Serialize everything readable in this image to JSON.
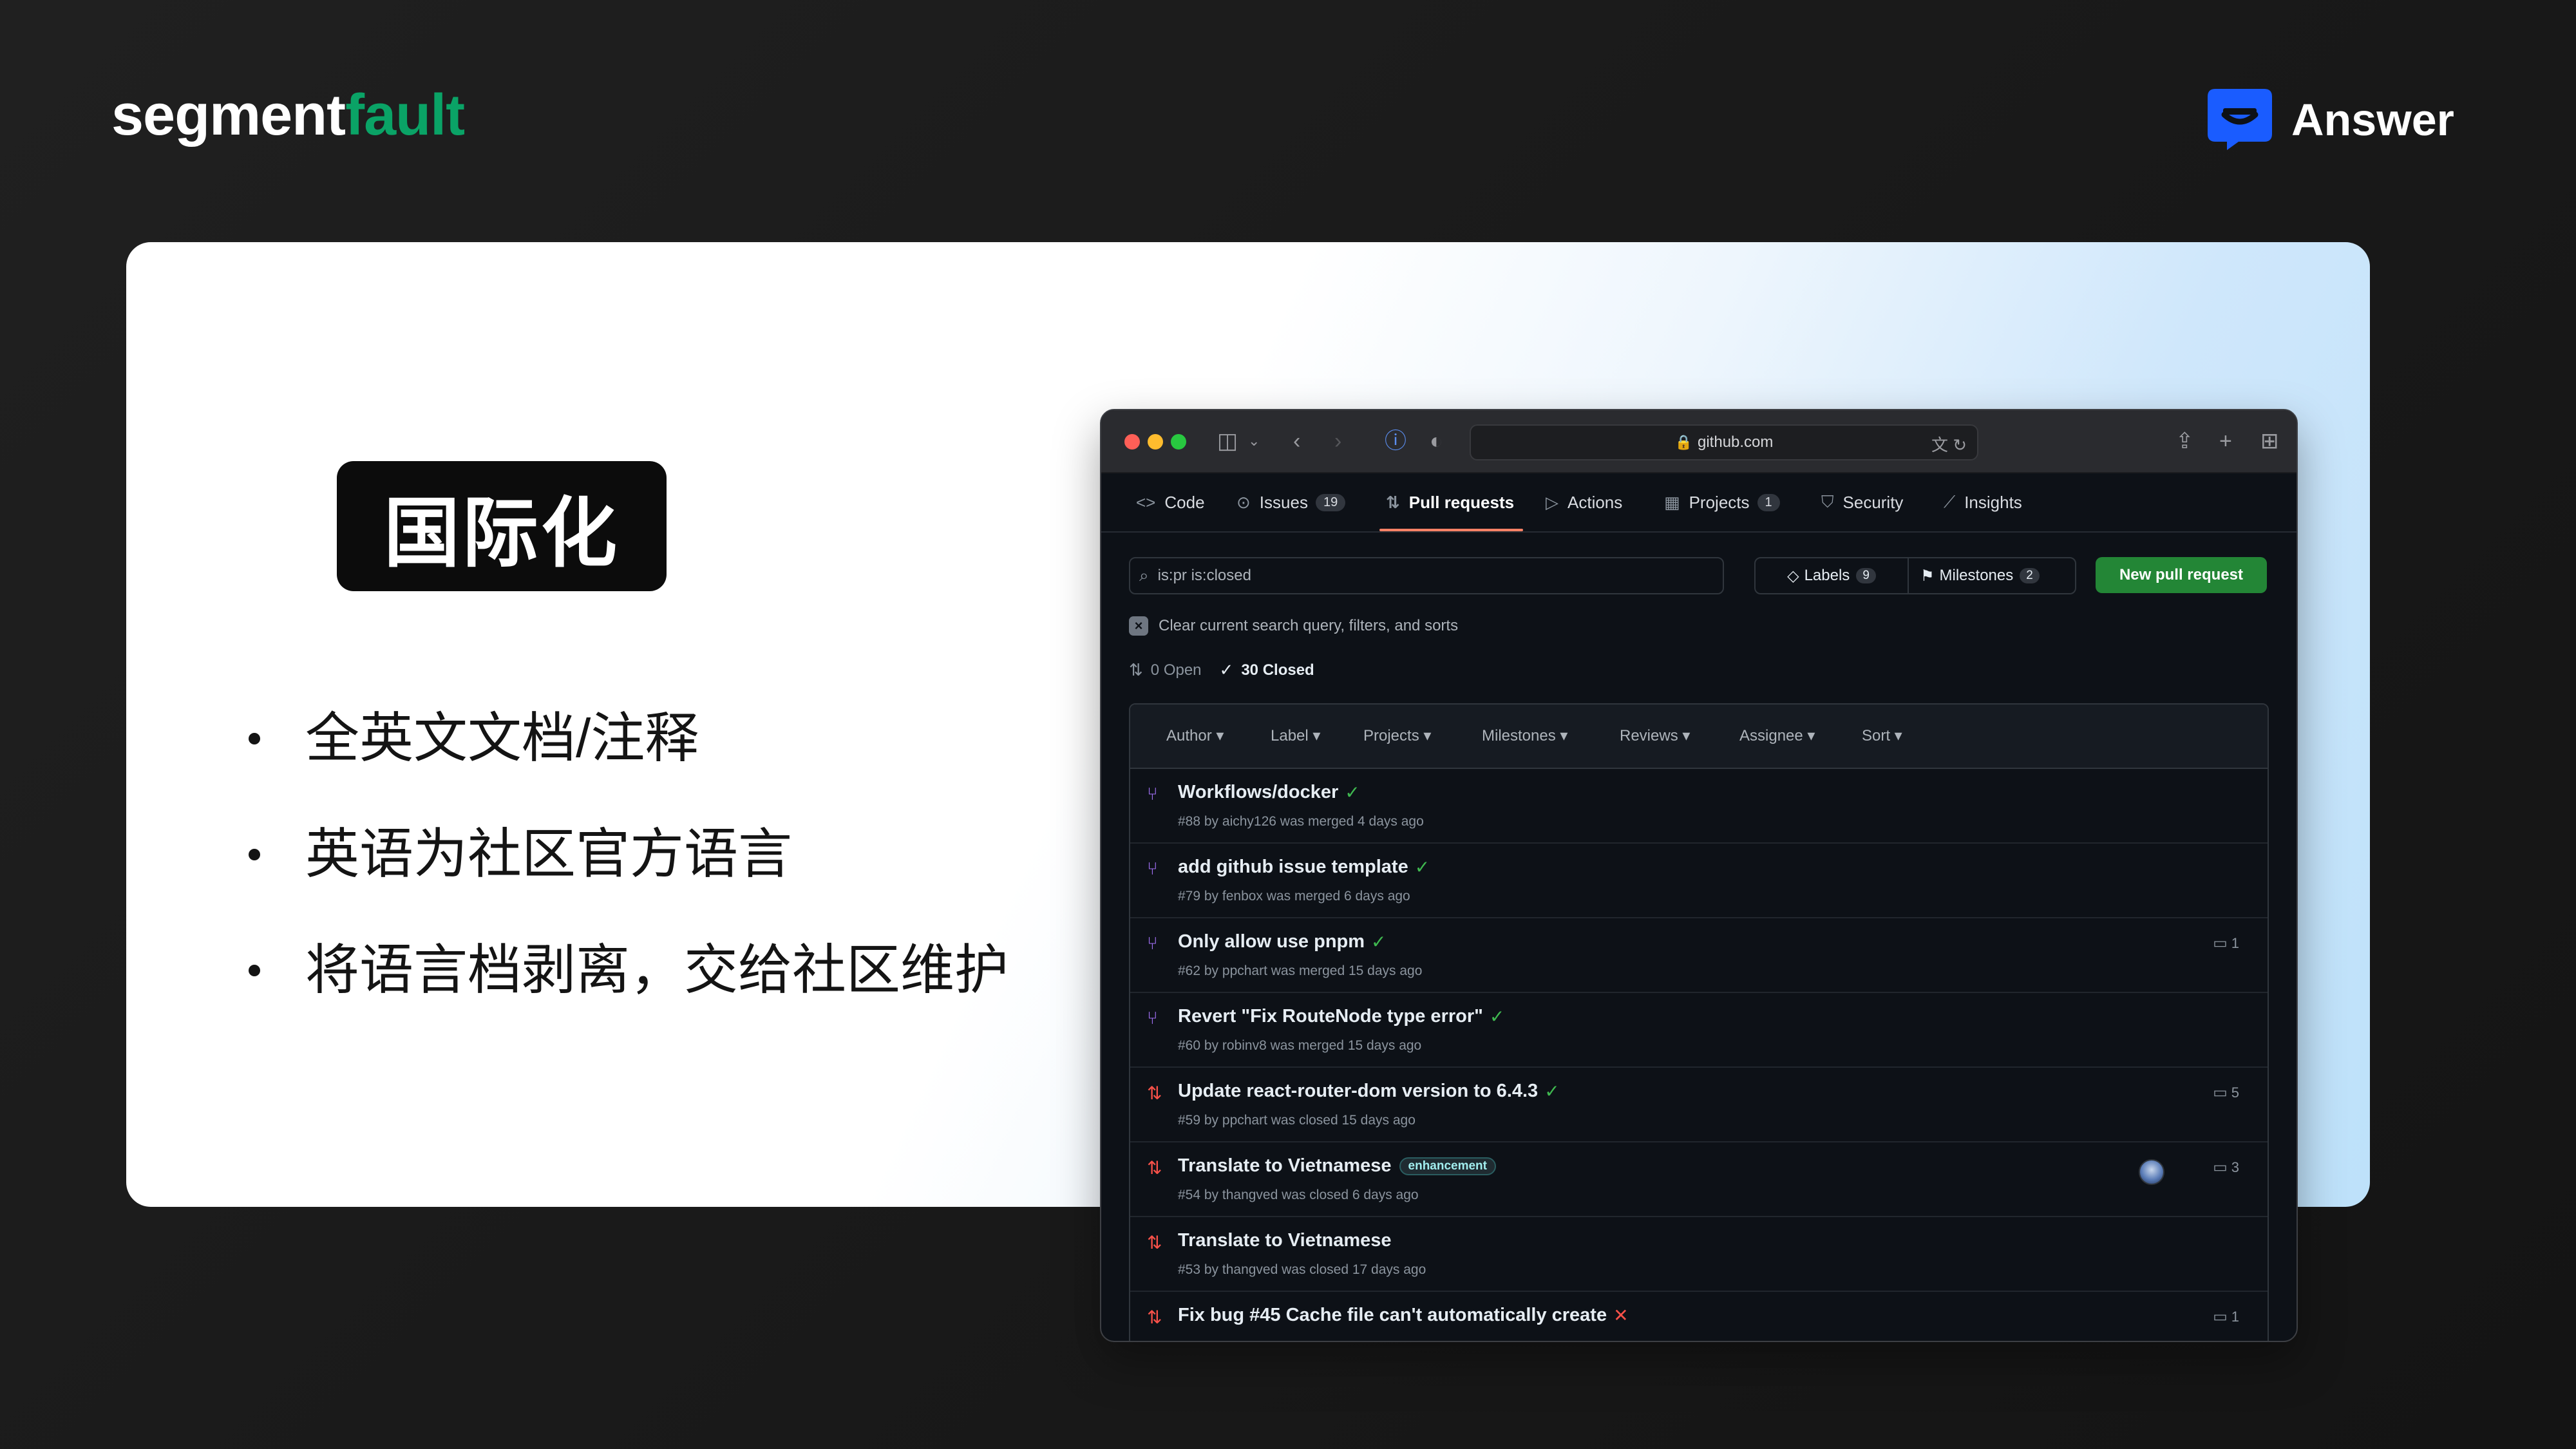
{
  "brand": {
    "segment": "segment",
    "fault": "fault",
    "answer": "Answer"
  },
  "slide": {
    "tag": "国际化",
    "bullets": [
      "全英文文档/注释",
      "英语为社区官方语言",
      "将语言档剥离，交给社区维护"
    ]
  },
  "browser": {
    "url": "github.com",
    "repo_tabs": [
      {
        "label": "Code",
        "icon": "code-icon"
      },
      {
        "label": "Issues",
        "icon": "issue-icon",
        "count": "19"
      },
      {
        "label": "Pull requests",
        "icon": "pull-request-icon",
        "active": true
      },
      {
        "label": "Actions",
        "icon": "play-icon"
      },
      {
        "label": "Projects",
        "icon": "table-icon",
        "count": "1"
      },
      {
        "label": "Security",
        "icon": "shield-icon"
      },
      {
        "label": "Insights",
        "icon": "graph-icon"
      }
    ],
    "search": {
      "value": "is:pr is:closed"
    },
    "labels": {
      "label": "Labels",
      "count": "9"
    },
    "milestones": {
      "label": "Milestones",
      "count": "2"
    },
    "new_pr": "New pull request",
    "clear_text": "Clear current search query, filters, and sorts",
    "open_state": "0 Open",
    "closed_state": "30 Closed",
    "filters": [
      "Author",
      "Label",
      "Projects",
      "Milestones",
      "Reviews",
      "Assignee",
      "Sort"
    ],
    "pull_requests": [
      {
        "title": "Workflows/docker",
        "meta": "#88 by aichy126 was merged 4 days ago",
        "state": "merged",
        "check": "success"
      },
      {
        "title": "add github issue template",
        "meta": "#79 by fenbox was merged 6 days ago",
        "state": "merged",
        "check": "success"
      },
      {
        "title": "Only allow use pnpm",
        "meta": "#62 by ppchart was merged 15 days ago",
        "state": "merged",
        "check": "success",
        "comments": "1"
      },
      {
        "title": "Revert \"Fix RouteNode type error\"",
        "meta": "#60 by robinv8 was merged 15 days ago",
        "state": "merged",
        "check": "success"
      },
      {
        "title": "Update react-router-dom version to 6.4.3",
        "meta": "#59 by ppchart was closed 15 days ago",
        "state": "closed",
        "check": "success",
        "comments": "5"
      },
      {
        "title": "Translate to Vietnamese",
        "meta": "#54 by thangved was closed 6 days ago",
        "state": "closed",
        "label": "enhancement",
        "comments": "3",
        "assignee": true
      },
      {
        "title": "Translate to Vietnamese",
        "meta": "#53 by thangved was closed 17 days ago",
        "state": "closed"
      },
      {
        "title": "Fix bug #45 Cache file can't automatically create",
        "meta": "",
        "state": "closed",
        "check": "failure",
        "comments": "1"
      }
    ]
  },
  "colors": {
    "sf_accent": "#0aa366",
    "answer_blue": "#1a5cff",
    "pr_green": "#238636",
    "merged": "#a371f7",
    "closed": "#f85149",
    "check_ok": "#3fb950"
  }
}
